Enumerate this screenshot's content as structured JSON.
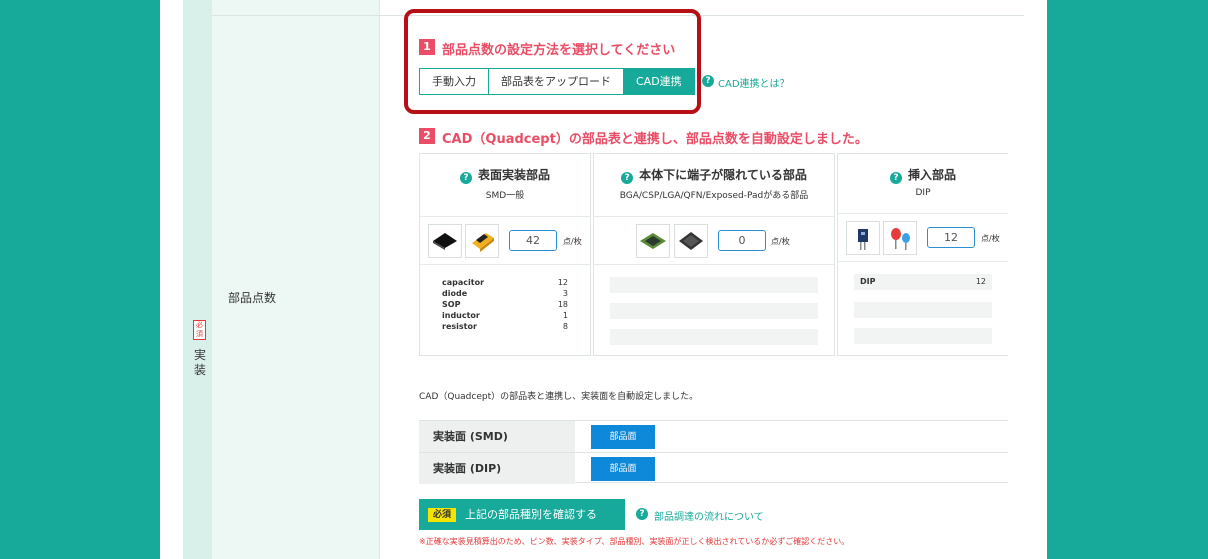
{
  "row": {
    "required_badge": "必須",
    "section_label": "実装",
    "label": "部品点数"
  },
  "step1": {
    "num": "1",
    "title": "部品点数の設定方法を選択してください",
    "options": [
      "手動入力",
      "部品表をアップロード",
      "CAD連携"
    ],
    "selected": "CAD連携",
    "help_link": "CAD連携とは？"
  },
  "step2": {
    "num": "2",
    "title": "CAD（Quadcept）の部品表と連携し、部品点数を自動設定しました。"
  },
  "categories": [
    {
      "name": "表面実装部品",
      "sub": "SMD一般",
      "count": "42",
      "unit": "点/枚",
      "thumb_icons": [
        "ic-chip-icon",
        "tantalum-capacitor-icon"
      ],
      "parts": [
        {
          "name": "capacitor",
          "qty": "12"
        },
        {
          "name": "diode",
          "qty": "3"
        },
        {
          "name": "SOP",
          "qty": "18"
        },
        {
          "name": "inductor",
          "qty": "1"
        },
        {
          "name": "resistor",
          "qty": "8"
        }
      ]
    },
    {
      "name": "本体下に端子が隠れている部品",
      "sub": "BGA/CSP/LGA/QFN/Exposed-Padがある部品",
      "count": "0",
      "unit": "点/枚",
      "thumb_icons": [
        "bga-chip-icon",
        "qfn-chip-icon"
      ],
      "parts": []
    },
    {
      "name": "挿入部品",
      "sub": "DIP",
      "count": "12",
      "unit": "点/枚",
      "thumb_icons": [
        "transistor-icon",
        "led-icon"
      ],
      "parts": [
        {
          "name": "DIP",
          "qty": "12"
        }
      ]
    }
  ],
  "auto_note": "CAD（Quadcept）の部品表と連携し、実装面を自動設定しました。",
  "mount": [
    {
      "label": "実装面 (SMD)",
      "button": "部品面"
    },
    {
      "label": "実装面 (DIP)",
      "button": "部品面"
    }
  ],
  "confirm": {
    "tag": "必須",
    "label": "上記の部品種別を確認する",
    "help_link": "部品調達の流れについて"
  },
  "warning": "※正確な実装見積算出のため、ピン数、実装タイプ、部品種別、実装面が正しく検出されているか必ずご確認ください。",
  "colors": {
    "teal": "#17a99a",
    "accent_red": "#e94e66",
    "highlight": "#b60f16",
    "button_blue": "#0e88d8"
  }
}
